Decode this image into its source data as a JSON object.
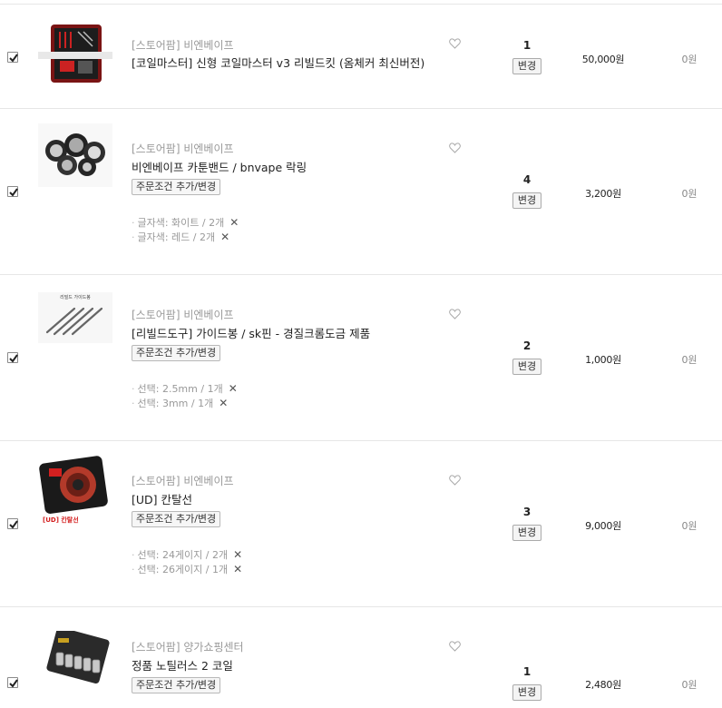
{
  "items": [
    {
      "shop": "[스토어팜] 비엔베이프",
      "name": "[코일마스터] 신형 코일마스터 v3 리빌드킷 (옴체커 최신버전)",
      "thumb_icon": "coil-kit-icon",
      "option_button": "",
      "options": [],
      "qty": "1",
      "change_label": "변경",
      "price": "50,000원",
      "discount": "0원"
    },
    {
      "shop": "[스토어팜] 비엔베이프",
      "name": "비엔베이프 카툰밴드 / bnvape 락링",
      "thumb_icon": "vape-band-icon",
      "option_button": "주문조건 추가/변경",
      "options": [
        "글자색: 화이트 / 2개",
        "글자색: 레드 / 2개"
      ],
      "qty": "4",
      "change_label": "변경",
      "price": "3,200원",
      "discount": "0원"
    },
    {
      "shop": "[스토어팜] 비엔베이프",
      "name": "[리빌드도구] 가이드봉 / sk핀 - 경질크롬도금 제품",
      "thumb_icon": "guide-rod-icon",
      "thumb_caption": "리빌드 가이드봉",
      "option_button": "주문조건 추가/변경",
      "options": [
        "선택: 2.5mm / 1개",
        "선택: 3mm / 1개"
      ],
      "qty": "2",
      "change_label": "변경",
      "price": "1,000원",
      "discount": "0원"
    },
    {
      "shop": "[스토어팜] 비엔베이프",
      "name": "[UD] 칸탈선",
      "thumb_icon": "kanthal-wire-icon",
      "thumb_caption": "[UD] 칸탈선",
      "option_button": "주문조건 추가/변경",
      "options": [
        "선택: 24게이지 / 2개",
        "선택: 26게이지 / 1개"
      ],
      "qty": "3",
      "change_label": "변경",
      "price": "9,000원",
      "discount": "0원"
    },
    {
      "shop": "[스토어팜] 양가쇼핑센터",
      "name": "정품 노틸러스 2 코일",
      "thumb_icon": "nautilus-coil-icon",
      "option_button": "주문조건 추가/변경",
      "options": [],
      "qty": "1",
      "change_label": "변경",
      "price": "2,480원",
      "discount": "0원"
    }
  ]
}
